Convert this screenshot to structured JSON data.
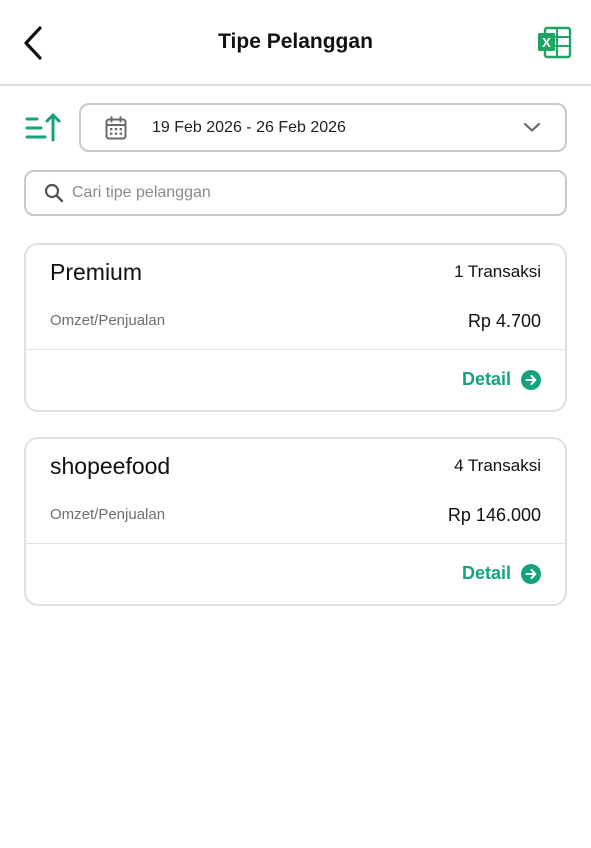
{
  "header": {
    "title": "Tipe Pelanggan",
    "back_icon": "chevron-left-icon",
    "export_icon": "excel-icon"
  },
  "filters": {
    "sort_icon": "sort-ascending-icon",
    "date_range": "19 Feb 2026 - 26 Feb 2026",
    "calendar_icon": "calendar-icon",
    "dropdown_icon": "chevron-down-icon"
  },
  "search": {
    "placeholder": "Cari tipe pelanggan",
    "value": ""
  },
  "customers": [
    {
      "name": "Premium",
      "transactions": "1 Transaksi",
      "omzet_label": "Omzet/Penjualan",
      "omzet_value": "Rp 4.700",
      "detail_label": "Detail"
    },
    {
      "name": "shopeefood",
      "transactions": "4 Transaksi",
      "omzet_label": "Omzet/Penjualan",
      "omzet_value": "Rp 146.000",
      "detail_label": "Detail"
    }
  ],
  "colors": {
    "accent": "#14a37f",
    "excel_green": "#1fa463"
  }
}
